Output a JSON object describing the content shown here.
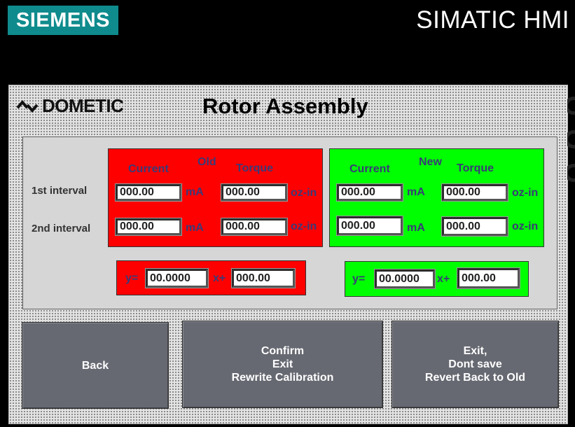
{
  "brand": {
    "siemens": "SIEMENS",
    "hmi": "SIMATIC HMI",
    "dometic": "DOMETIC"
  },
  "page": {
    "title": "Rotor Assembly"
  },
  "rows": {
    "first": "1st interval",
    "second": "2nd interval"
  },
  "old": {
    "header": "Old",
    "current_label": "Current",
    "torque_label": "Torque",
    "i1_current": "000.00",
    "i1_torque": "000.00",
    "i2_current": "000.00",
    "i2_torque": "000.00",
    "unit_current": "mA",
    "unit_torque": "oz-in",
    "eq_y": "y=",
    "eq_x": "x+",
    "slope": "00.0000",
    "offset": "000.00"
  },
  "new": {
    "header": "New",
    "current_label": "Current",
    "torque_label": "Torque",
    "i1_current": "000.00",
    "i1_torque": "000.00",
    "i2_current": "000.00",
    "i2_torque": "000.00",
    "unit_current": "mA",
    "unit_torque": "oz-in",
    "eq_y": "y=",
    "eq_x": "x+",
    "slope": "00.0000",
    "offset": "000.00"
  },
  "buttons": {
    "back": "Back",
    "confirm": [
      "Confirm",
      "Exit",
      "Rewrite Calibration"
    ],
    "exit": [
      "Exit,",
      "Dont save",
      "Revert Back to Old"
    ]
  },
  "colors": {
    "old_panel": "#ff0000",
    "new_panel": "#00ff00",
    "siemens_teal": "#0f8b8d",
    "button": "#676972"
  }
}
